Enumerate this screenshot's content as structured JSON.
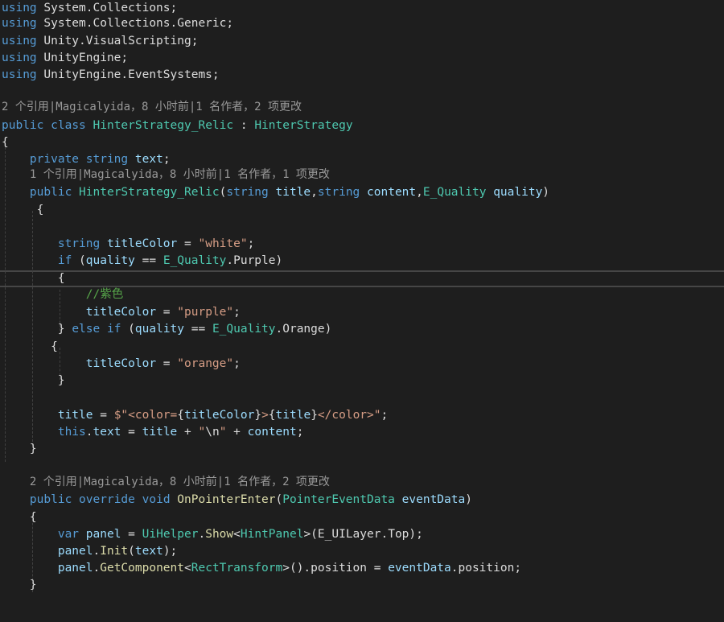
{
  "lines": [
    [
      [
        "kw",
        "using"
      ],
      [
        "pl",
        " System.Collections;"
      ]
    ],
    [
      [
        "kw",
        "using"
      ],
      [
        "pl",
        " System.Collections.Generic;"
      ]
    ],
    [
      [
        "kw",
        "using"
      ],
      [
        "pl",
        " Unity.VisualScripting;"
      ]
    ],
    [
      [
        "kw",
        "using"
      ],
      [
        "pl",
        " UnityEngine;"
      ]
    ],
    [
      [
        "kw",
        "using"
      ],
      [
        "pl",
        " UnityEngine.EventSystems;"
      ]
    ],
    [],
    [
      [
        "lens",
        "2 个引用|Magicalyida，8 小时前|1 名作者，2 项更改"
      ]
    ],
    [
      [
        "kw",
        "public"
      ],
      [
        "pl",
        " "
      ],
      [
        "kw",
        "class"
      ],
      [
        "pl",
        " "
      ],
      [
        "ty",
        "HinterStrategy_Relic"
      ],
      [
        "pl",
        " : "
      ],
      [
        "ty",
        "HinterStrategy"
      ]
    ],
    [
      [
        "pl",
        "{"
      ]
    ],
    [
      [
        "pl",
        "    "
      ],
      [
        "kw",
        "private"
      ],
      [
        "pl",
        " "
      ],
      [
        "kw",
        "string"
      ],
      [
        "pl",
        " "
      ],
      [
        "var",
        "text"
      ],
      [
        "pl",
        ";"
      ]
    ],
    [
      [
        "pl",
        "    "
      ],
      [
        "lens",
        "1 个引用|Magicalyida，8 小时前|1 名作者，1 项更改"
      ]
    ],
    [
      [
        "pl",
        "    "
      ],
      [
        "kw",
        "public"
      ],
      [
        "pl",
        " "
      ],
      [
        "ty",
        "HinterStrategy_Relic"
      ],
      [
        "pl",
        "("
      ],
      [
        "kw",
        "string"
      ],
      [
        "pl",
        " "
      ],
      [
        "var",
        "title"
      ],
      [
        "pl",
        ","
      ],
      [
        "kw",
        "string"
      ],
      [
        "pl",
        " "
      ],
      [
        "var",
        "content"
      ],
      [
        "pl",
        ","
      ],
      [
        "ty",
        "E_Quality"
      ],
      [
        "pl",
        " "
      ],
      [
        "var",
        "quality"
      ],
      [
        "pl",
        ")"
      ]
    ],
    [
      [
        "pl",
        "     {"
      ]
    ],
    [],
    [
      [
        "pl",
        "        "
      ],
      [
        "kw",
        "string"
      ],
      [
        "pl",
        " "
      ],
      [
        "var",
        "titleColor"
      ],
      [
        "pl",
        " = "
      ],
      [
        "str",
        "\"white\""
      ],
      [
        "pl",
        ";"
      ]
    ],
    [
      [
        "pl",
        "        "
      ],
      [
        "kw",
        "if"
      ],
      [
        "pl",
        " ("
      ],
      [
        "var",
        "quality"
      ],
      [
        "pl",
        " == "
      ],
      [
        "ty",
        "E_Quality"
      ],
      [
        "pl",
        ".Purple)"
      ]
    ],
    [
      [
        "pl",
        "        {"
      ]
    ],
    [
      [
        "pl",
        "            "
      ],
      [
        "cm",
        "//紫色"
      ]
    ],
    [
      [
        "pl",
        "            "
      ],
      [
        "var",
        "titleColor"
      ],
      [
        "pl",
        " = "
      ],
      [
        "str",
        "\"purple\""
      ],
      [
        "pl",
        ";"
      ]
    ],
    [
      [
        "pl",
        "        } "
      ],
      [
        "kw",
        "else"
      ],
      [
        "pl",
        " "
      ],
      [
        "kw",
        "if"
      ],
      [
        "pl",
        " ("
      ],
      [
        "var",
        "quality"
      ],
      [
        "pl",
        " == "
      ],
      [
        "ty",
        "E_Quality"
      ],
      [
        "pl",
        ".Orange)"
      ]
    ],
    [
      [
        "pl",
        "       {"
      ]
    ],
    [
      [
        "pl",
        "            "
      ],
      [
        "var",
        "titleColor"
      ],
      [
        "pl",
        " = "
      ],
      [
        "str",
        "\"orange\""
      ],
      [
        "pl",
        ";"
      ]
    ],
    [
      [
        "pl",
        "        }"
      ]
    ],
    [],
    [
      [
        "pl",
        "        "
      ],
      [
        "var",
        "title"
      ],
      [
        "pl",
        " = "
      ],
      [
        "str",
        "$\"<color="
      ],
      [
        "pl",
        "{"
      ],
      [
        "var",
        "titleColor"
      ],
      [
        "pl",
        "}"
      ],
      [
        "str",
        ">"
      ],
      [
        "pl",
        "{"
      ],
      [
        "var",
        "title"
      ],
      [
        "pl",
        "}"
      ],
      [
        "str",
        "</color>\""
      ],
      [
        "pl",
        ";"
      ]
    ],
    [
      [
        "pl",
        "        "
      ],
      [
        "kw",
        "this"
      ],
      [
        "pl",
        "."
      ],
      [
        "var",
        "text"
      ],
      [
        "pl",
        " = "
      ],
      [
        "var",
        "title"
      ],
      [
        "pl",
        " + "
      ],
      [
        "str",
        "\""
      ],
      [
        "pl",
        "\\n"
      ],
      [
        "str",
        "\""
      ],
      [
        "pl",
        " + "
      ],
      [
        "var",
        "content"
      ],
      [
        "pl",
        ";"
      ]
    ],
    [
      [
        "pl",
        "    }"
      ]
    ],
    [],
    [
      [
        "pl",
        "    "
      ],
      [
        "lens",
        "2 个引用|Magicalyida，8 小时前|1 名作者，2 项更改"
      ]
    ],
    [
      [
        "pl",
        "    "
      ],
      [
        "kw",
        "public"
      ],
      [
        "pl",
        " "
      ],
      [
        "kw",
        "override"
      ],
      [
        "pl",
        " "
      ],
      [
        "kw",
        "void"
      ],
      [
        "pl",
        " "
      ],
      [
        "fn",
        "OnPointerEnter"
      ],
      [
        "pl",
        "("
      ],
      [
        "ty",
        "PointerEventData"
      ],
      [
        "pl",
        " "
      ],
      [
        "var",
        "eventData"
      ],
      [
        "pl",
        ")"
      ]
    ],
    [
      [
        "pl",
        "    {"
      ]
    ],
    [
      [
        "pl",
        "        "
      ],
      [
        "kw",
        "var"
      ],
      [
        "pl",
        " "
      ],
      [
        "var",
        "panel"
      ],
      [
        "pl",
        " = "
      ],
      [
        "ty",
        "UiHelper"
      ],
      [
        "pl",
        "."
      ],
      [
        "fn",
        "Show"
      ],
      [
        "pl",
        "<"
      ],
      [
        "ty",
        "HintPanel"
      ],
      [
        "pl",
        ">(E_UILayer.Top);"
      ]
    ],
    [
      [
        "pl",
        "        "
      ],
      [
        "var",
        "panel"
      ],
      [
        "pl",
        "."
      ],
      [
        "fn",
        "Init"
      ],
      [
        "pl",
        "("
      ],
      [
        "var",
        "text"
      ],
      [
        "pl",
        ");"
      ]
    ],
    [
      [
        "pl",
        "        "
      ],
      [
        "var",
        "panel"
      ],
      [
        "pl",
        "."
      ],
      [
        "fn",
        "GetComponent"
      ],
      [
        "pl",
        "<"
      ],
      [
        "ty",
        "RectTransform"
      ],
      [
        "pl",
        ">().position = "
      ],
      [
        "var",
        "eventData"
      ],
      [
        "pl",
        ".position;"
      ]
    ],
    [
      [
        "pl",
        "    }"
      ]
    ]
  ]
}
